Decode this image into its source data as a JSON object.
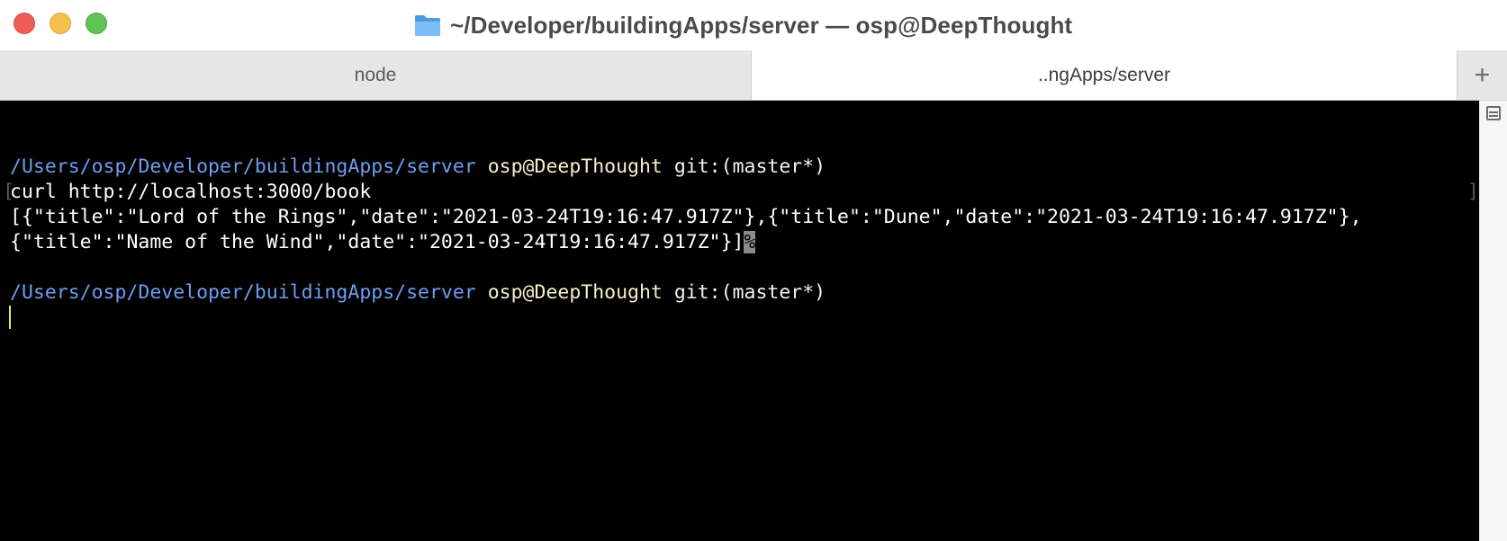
{
  "window": {
    "title": "~/Developer/buildingApps/server — osp@DeepThought",
    "title_icon": "folder-icon"
  },
  "tabs": [
    {
      "label": "node",
      "active": false
    },
    {
      "label": "..ngApps/server",
      "active": true
    }
  ],
  "new_tab_label": "+",
  "terminal": {
    "prompt1": {
      "path": "/Users/osp/Developer/buildingApps/server",
      "user": "osp@DeepThought",
      "git": "git:(master*)"
    },
    "command": "curl http://localhost:3000/book",
    "output_line1": "[{\"title\":\"Lord of the Rings\",\"date\":\"2021-03-24T19:16:47.917Z\"},{\"title\":\"Dune\",\"date\":\"2021-03-24T19:16:47.917Z\"},",
    "output_line2": "{\"title\":\"Name of the Wind\",\"date\":\"2021-03-24T19:16:47.917Z\"}]",
    "no_newline_marker": "%",
    "prompt2": {
      "path": "/Users/osp/Developer/buildingApps/server",
      "user": "osp@DeepThought",
      "git": "git:(master*)"
    }
  },
  "colors": {
    "path": "#6d9ef0",
    "user": "#f5efc8",
    "cursor": "#e8e85a",
    "background": "#000000"
  }
}
